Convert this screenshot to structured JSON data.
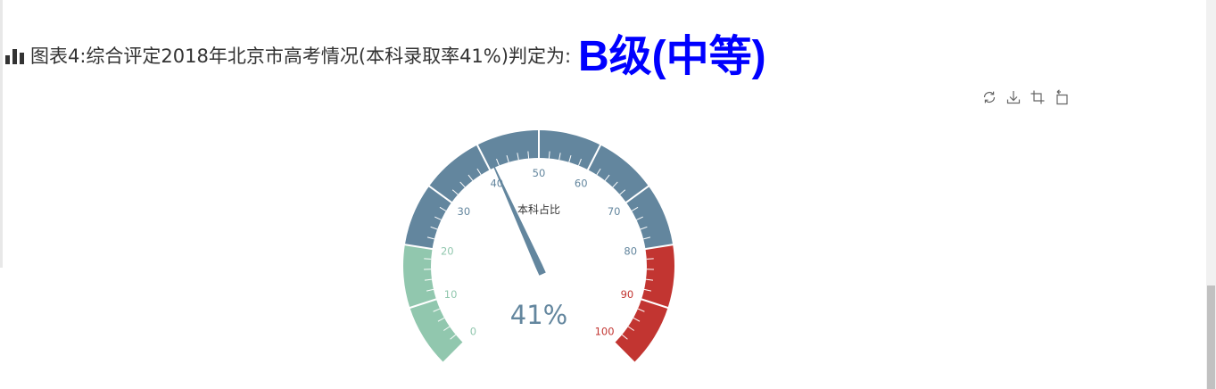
{
  "heading": {
    "text": "图表4:综合评定2018年北京市高考情况(本科录取率41%)判定为:",
    "grade": "B级(中等)"
  },
  "toolbox": [
    {
      "name": "restore-icon"
    },
    {
      "name": "download-icon"
    },
    {
      "name": "zoom-icon"
    },
    {
      "name": "zoom-back-icon"
    }
  ],
  "chart_data": {
    "type": "gauge",
    "min": 0,
    "max": 100,
    "value": 41,
    "series_name": "本科占比",
    "detail": "41%",
    "split_number": 10,
    "tick_labels": [
      "0",
      "10",
      "20",
      "30",
      "40",
      "50",
      "60",
      "70",
      "80",
      "90",
      "100"
    ],
    "color_bands": [
      {
        "to": 0.2,
        "color": "#91c7ae"
      },
      {
        "to": 0.8,
        "color": "#63869e"
      },
      {
        "to": 1.0,
        "color": "#c23531"
      }
    ]
  }
}
